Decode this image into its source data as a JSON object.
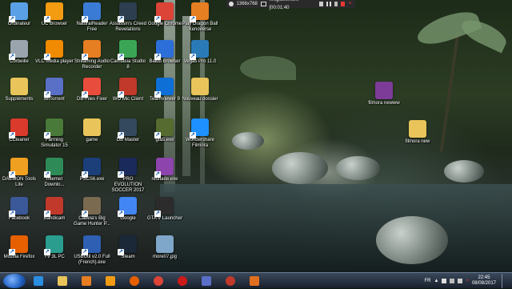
{
  "recorder": {
    "resolution": "1366x768",
    "status": "nregistrement [00:01:40"
  },
  "desktop": {
    "columns": [
      [
        {
          "label": "Ordinateur",
          "icon": "computer-icon",
          "color": "#5aa0e6"
        },
        {
          "label": "Corbeille",
          "icon": "recycle-bin-icon",
          "color": "#9aa4ad"
        },
        {
          "label": "Suppléments",
          "icon": "folder-icon",
          "color": "#e8c45a"
        },
        {
          "label": "CCleaner",
          "icon": "ccleaner-icon",
          "color": "#d93a2b"
        },
        {
          "label": "DAEMON Tools\nLite",
          "icon": "daemon-tools-icon",
          "color": "#f0a020"
        },
        {
          "label": "Facebook",
          "icon": "facebook-icon",
          "color": "#3b5998"
        },
        {
          "label": "Mozilla Firefox",
          "icon": "firefox-icon",
          "color": "#e66000"
        }
      ],
      [
        {
          "label": "UC Browser",
          "icon": "uc-browser-icon",
          "color": "#f39c12"
        },
        {
          "label": "VLC media player",
          "icon": "vlc-icon",
          "color": "#f08a00"
        },
        {
          "label": "BitTorrent",
          "icon": "bittorrent-icon",
          "color": "#5a6fc6"
        },
        {
          "label": "Farming\nSimulator 15",
          "icon": "farming-simulator-icon",
          "color": "#4a7a3a"
        },
        {
          "label": "Internet\nDownlo...",
          "icon": "idm-icon",
          "color": "#2e8b57"
        },
        {
          "label": "Bandicam",
          "icon": "bandicam-icon",
          "color": "#c0392b"
        },
        {
          "label": "TV 3L PC",
          "icon": "tv-icon",
          "color": "#2a9d8f"
        }
      ],
      [
        {
          "label": "NaturalReader\nFree",
          "icon": "naturalreader-icon",
          "color": "#3a7bd5"
        },
        {
          "label": "Streaming Audio\nRecorder",
          "icon": "audio-recorder-icon",
          "color": "#e67e22"
        },
        {
          "label": "DB-Files Fixer",
          "icon": "db-fixer-icon",
          "color": "#e74c3c"
        },
        {
          "label": "game",
          "icon": "folder-icon",
          "color": "#e8c45a"
        },
        {
          "label": "PSCS6.exe",
          "icon": "photoshop-icon",
          "color": "#1c3f7a"
        },
        {
          "label": "Cabela's Big\nGame Hunter P...",
          "icon": "game-icon",
          "color": "#7a6a50"
        },
        {
          "label": "USBUtil v2.0 Full\n(French).exe",
          "icon": "usb-util-icon",
          "color": "#2f5fb3"
        }
      ],
      [
        {
          "label": "Assassin's Creed\nRevelations",
          "icon": "assassins-creed-icon",
          "color": "#2c3e50"
        },
        {
          "label": "Camtasia Studio\n8",
          "icon": "camtasia-icon",
          "color": "#3aa655"
        },
        {
          "label": "WO Mic Client",
          "icon": "wo-mic-icon",
          "color": "#c0392b"
        },
        {
          "label": "DB Master",
          "icon": "db-master-icon",
          "color": "#34495e"
        },
        {
          "label": "PRO EVOLUTION\nSOCCER 2017",
          "icon": "pes-icon",
          "color": "#1a2a5a"
        },
        {
          "label": "Google",
          "icon": "google-icon",
          "color": "#4285f4"
        },
        {
          "label": "Steam",
          "icon": "steam-icon",
          "color": "#1b2838"
        }
      ],
      [
        {
          "label": "Google Chrome",
          "icon": "chrome-icon",
          "color": "#db4437"
        },
        {
          "label": "Baidu Browser",
          "icon": "baidu-icon",
          "color": "#2d6fd8"
        },
        {
          "label": "TeamViewer 9",
          "icon": "teamviewer-icon",
          "color": "#0e6fd6"
        },
        {
          "label": "gta5.exe",
          "icon": "gta-icon",
          "color": "#556b2f"
        },
        {
          "label": "reshade.exe",
          "icon": "reshade-icon",
          "color": "#8e44ad"
        },
        {
          "label": "GTA V Launcher",
          "icon": "gta-launcher-icon",
          "color": "#2c2c2c"
        },
        {
          "label": "more07.jpg",
          "icon": "image-icon",
          "color": "#7fa7c9"
        }
      ],
      [
        {
          "label": "Play Dragon Ball\nXenoverse",
          "icon": "dragon-ball-icon",
          "color": "#e67e22"
        },
        {
          "label": "Vegas Pro 11.0",
          "icon": "vegas-icon",
          "color": "#2a7ab8"
        },
        {
          "label": "Nouveau dossier",
          "icon": "folder-icon",
          "color": "#e8c45a"
        },
        {
          "label": "Wondershare\nFilmora",
          "icon": "filmora-icon",
          "color": "#1e90ff"
        },
        {
          "label": "",
          "icon": "",
          "color": ""
        },
        {
          "label": "",
          "icon": "",
          "color": ""
        },
        {
          "label": "",
          "icon": "",
          "color": ""
        }
      ]
    ],
    "extra": [
      {
        "label": "filmora newww",
        "icon": "winrar-icon",
        "color": "#7d3c98"
      },
      {
        "label": "filmora new",
        "icon": "folder-icon",
        "color": "#e8c45a"
      }
    ]
  },
  "taskbar": {
    "apps": [
      {
        "name": "internet-explorer-icon",
        "color": "#2a8ee0"
      },
      {
        "name": "file-explorer-icon",
        "color": "#e8c45a"
      },
      {
        "name": "media-player-icon",
        "color": "#e67e22"
      },
      {
        "name": "uc-browser-icon",
        "color": "#f39c12"
      },
      {
        "name": "firefox-icon",
        "color": "#e66000"
      },
      {
        "name": "chrome-icon",
        "color": "#db4437"
      },
      {
        "name": "opera-icon",
        "color": "#cc1a1a"
      },
      {
        "name": "bittorrent-icon",
        "color": "#5a6fc6"
      },
      {
        "name": "bandicam-icon",
        "color": "#c0392b"
      },
      {
        "name": "microphone-icon",
        "color": "#e07020"
      }
    ],
    "language": "FR",
    "time": "22:45",
    "date": "08/08/2017"
  }
}
